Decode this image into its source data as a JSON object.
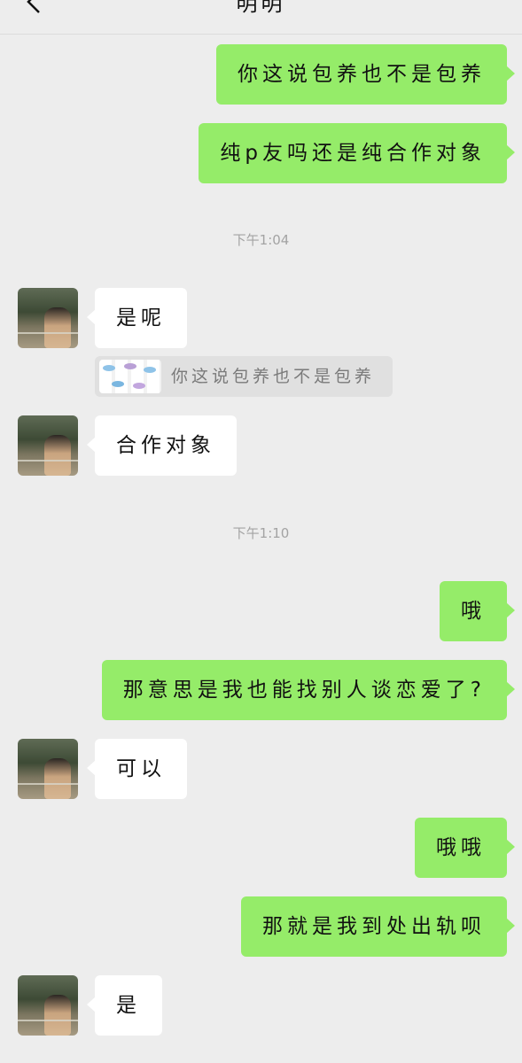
{
  "header": {
    "title": "明明",
    "back_icon": "chevron-left-icon"
  },
  "messages": [
    {
      "side": "out",
      "text": "你这说包养也不是包养"
    },
    {
      "side": "out",
      "text": "纯p友吗还是纯合作对象"
    },
    {
      "type": "time",
      "text": "下午1:04"
    },
    {
      "side": "in",
      "text": "是呢",
      "quote": {
        "text": "你这说包养也不是包养",
        "thumb": "fish-pattern-image"
      }
    },
    {
      "side": "in",
      "text": "合作对象"
    },
    {
      "type": "time",
      "text": "下午1:10"
    },
    {
      "side": "out",
      "text": "哦"
    },
    {
      "side": "out",
      "text": "那意思是我也能找别人谈恋爱了?"
    },
    {
      "side": "in",
      "text": "可以"
    },
    {
      "side": "out",
      "text": "哦哦"
    },
    {
      "side": "out",
      "text": "那就是我到处出轨呗"
    },
    {
      "side": "in",
      "text": "是"
    }
  ],
  "colors": {
    "background": "#ededed",
    "outgoing_bubble": "#95ec69",
    "incoming_bubble": "#ffffff",
    "quote_background": "#e0e0e0",
    "timestamp_text": "#a3a3a3"
  }
}
